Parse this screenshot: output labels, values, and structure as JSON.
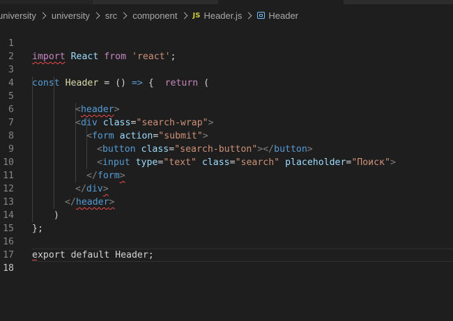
{
  "breadcrumb": {
    "items": [
      "university",
      "university",
      "src",
      "component"
    ],
    "file_icon": "JS",
    "file": "Header.js",
    "symbol": "Header"
  },
  "editor": {
    "line_numbers": [
      "1",
      "2",
      "3",
      "4",
      "5",
      "6",
      "7",
      "8",
      "9",
      "10",
      "11",
      "12",
      "13",
      "14",
      "15",
      "16",
      "17",
      "18"
    ],
    "active_line": "18",
    "code": {
      "l1_import": "import",
      "l1_react": "React",
      "l1_from": "from",
      "l1_str": "'react'",
      "l1_semi": ";",
      "l3_const": "const",
      "l3_header": "Header",
      "l3_eq": " = () ",
      "l3_arrow": "=>",
      "l3_brace": " {  ",
      "l3_return": "return",
      "l3_paren": " (",
      "l5_lt": "<",
      "l5_tag": "header",
      "l5_gt": ">",
      "l6_lt": "<",
      "l6_tag": "div",
      "l6_attr": "class",
      "l6_eq": "=",
      "l6_val": "\"search-wrap\"",
      "l6_gt": ">",
      "l7_lt": "<",
      "l7_tag": "form",
      "l7_attr": "action",
      "l7_eq": "=",
      "l7_val": "\"submit\"",
      "l7_gt": ">",
      "l8_lt": "<",
      "l8_tag": "button",
      "l8_attr": "class",
      "l8_eq": "=",
      "l8_val": "\"search-button\"",
      "l8_mid": "></",
      "l8_tag2": "button",
      "l8_gt": ">",
      "l9_lt": "<",
      "l9_tag": "input",
      "l9_attr1": "type",
      "l9_eq1": "=",
      "l9_val1": "\"text\"",
      "l9_attr2": "class",
      "l9_eq2": "=",
      "l9_val2": "\"search\"",
      "l9_attr3": "placeholder",
      "l9_eq3": "=",
      "l9_val3": "\"Поиск\"",
      "l9_gt": ">",
      "l10_lt": "</",
      "l10_tag": "form",
      "l10_gt": ">",
      "l11_lt": "</",
      "l11_tag": "div",
      "l11_gt": ">",
      "l12_lt": "</",
      "l12_tag": "header",
      "l12_gt": ">",
      "l13": ")",
      "l14": "};",
      "l16_export": "export",
      "l16_default": "default",
      "l16_header": "Header",
      "l16_semi": ";"
    }
  },
  "colors": {
    "background": "#1e1e1e",
    "keyword": "#569cd6",
    "control": "#c586c0",
    "string": "#ce9178",
    "attribute": "#9cdcfe",
    "error_squiggle": "#f14c4c"
  }
}
